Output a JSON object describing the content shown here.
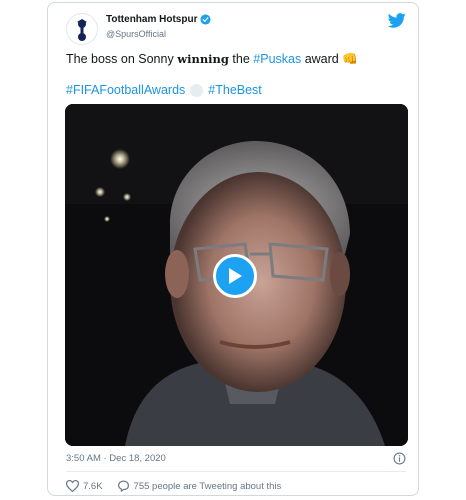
{
  "tweet": {
    "author_name": "Tottenham Hotspur",
    "handle": "@SpursOfficial",
    "text_prefix": "The boss on Sonny ",
    "text_bold": "winning",
    "text_mid": " the ",
    "text_link": "#Puskas",
    "text_suffix": " award ",
    "text_emoji": "👊",
    "hashtag_1": "#FIFAFootballAwards",
    "hashtag_2": "#TheBest",
    "timestamp": "3:50 AM · Dec 18, 2020",
    "likes": "7.6K",
    "tweeting_about": "755 people are Tweeting about this"
  },
  "colors": {
    "accent": "#1da1f2",
    "link": "#1b95e0",
    "muted": "#657786",
    "like_red": "#e0245e"
  },
  "icons": [
    "spurs-logo-icon",
    "verified-badge-icon",
    "twitter-bird-icon",
    "play-icon",
    "info-icon",
    "heart-icon",
    "comment-icon"
  ]
}
